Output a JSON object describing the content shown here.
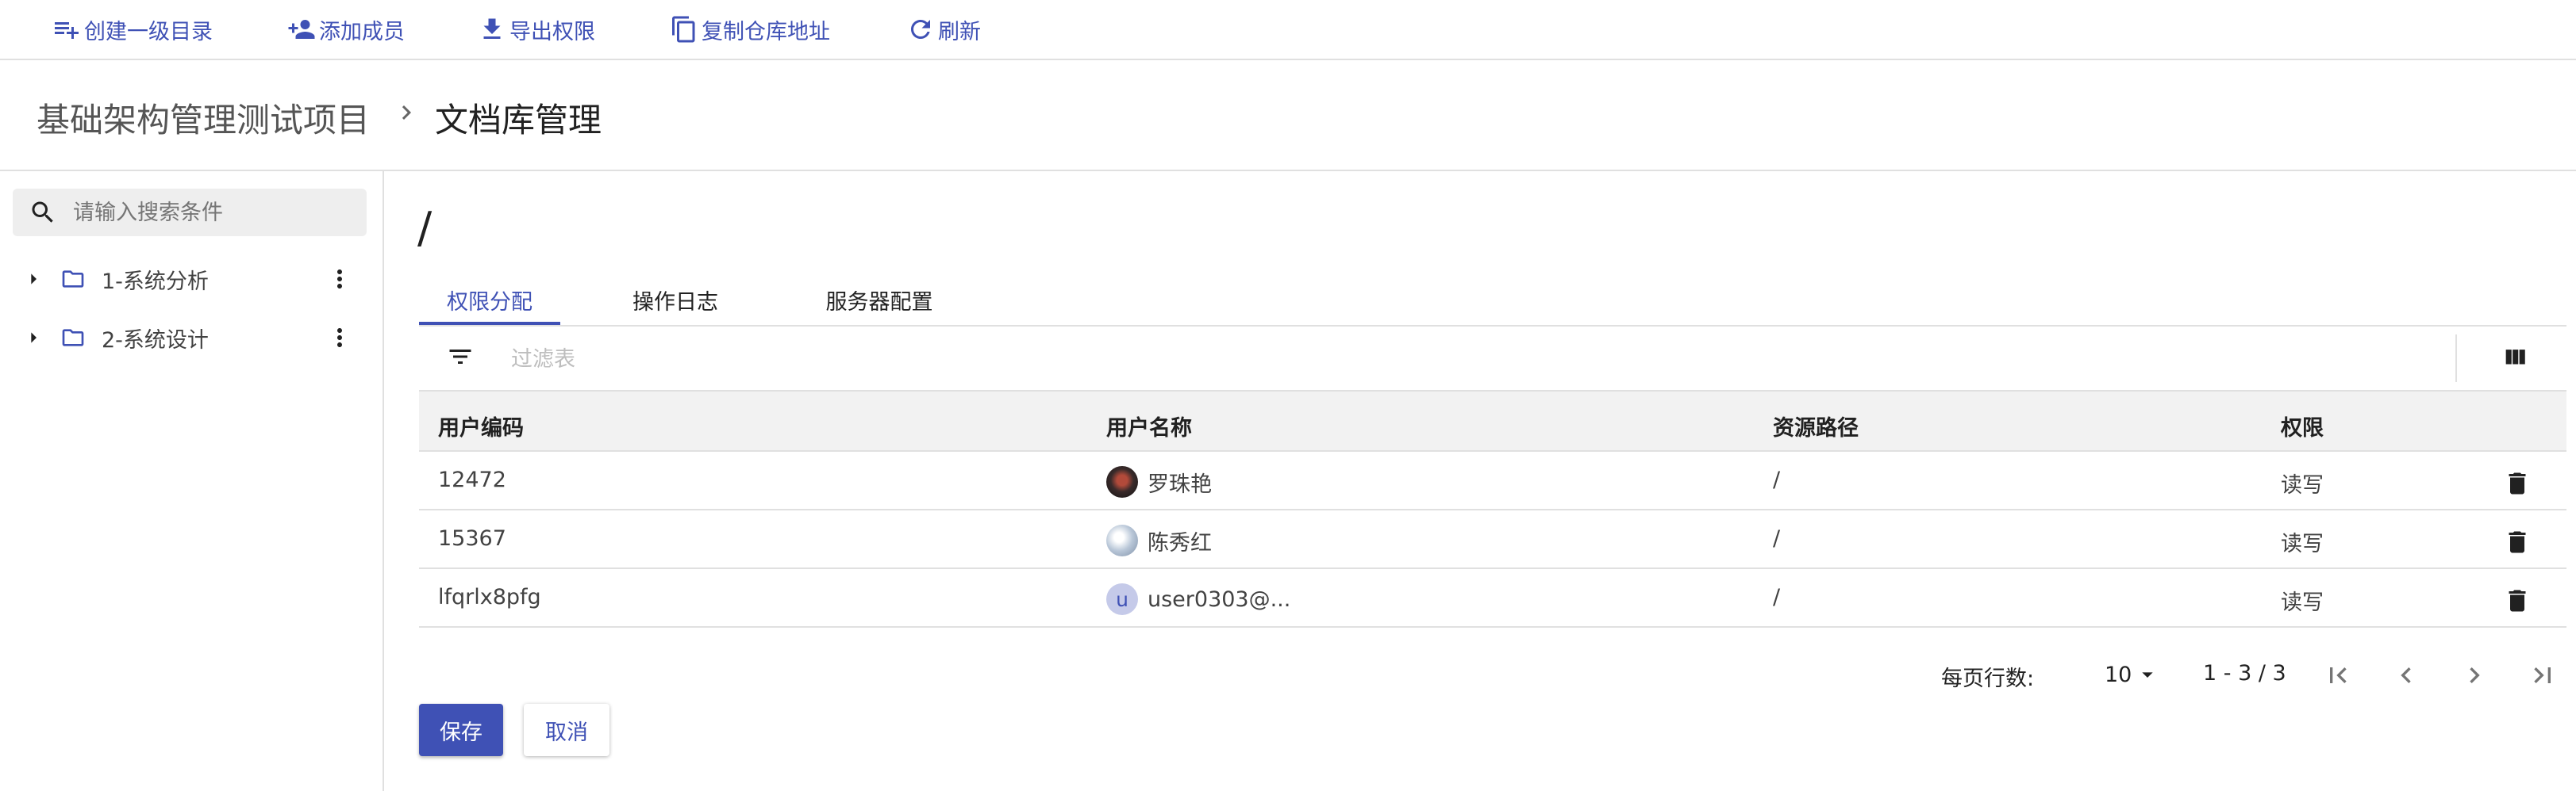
{
  "toolbar": {
    "create_dir": "创建一级目录",
    "add_member": "添加成员",
    "export_perm": "导出权限",
    "copy_repo_url": "复制仓库地址",
    "refresh": "刷新"
  },
  "breadcrumb": {
    "project": "基础架构管理测试项目",
    "current": "文档库管理"
  },
  "sidebar": {
    "search_placeholder": "请输入搜索条件",
    "items": [
      {
        "label": "1-系统分析"
      },
      {
        "label": "2-系统设计"
      }
    ]
  },
  "main": {
    "path": "/",
    "tabs": [
      {
        "label": "权限分配",
        "active": true
      },
      {
        "label": "操作日志",
        "active": false
      },
      {
        "label": "服务器配置",
        "active": false
      }
    ],
    "filter_placeholder": "过滤表",
    "columns": [
      "用户编码",
      "用户名称",
      "资源路径",
      "权限"
    ],
    "rows": [
      {
        "code": "12472",
        "name": "罗珠艳",
        "avatar": "photo",
        "path": "/",
        "permission": "读写"
      },
      {
        "code": "15367",
        "name": "陈秀红",
        "avatar": "photo",
        "path": "/",
        "permission": "读写"
      },
      {
        "code": "lfqrlx8pfg",
        "name": "user0303@...",
        "avatar": "u",
        "path": "/",
        "permission": "读写"
      }
    ],
    "pagination": {
      "rows_per_page_label": "每页行数:",
      "rows_per_page": "10",
      "range": "1 - 3 / 3"
    },
    "save_label": "保存",
    "cancel_label": "取消"
  },
  "colors": {
    "accent": "#3f51b5",
    "header_bg": "#f2f2f2",
    "border": "#e0e0e0"
  }
}
